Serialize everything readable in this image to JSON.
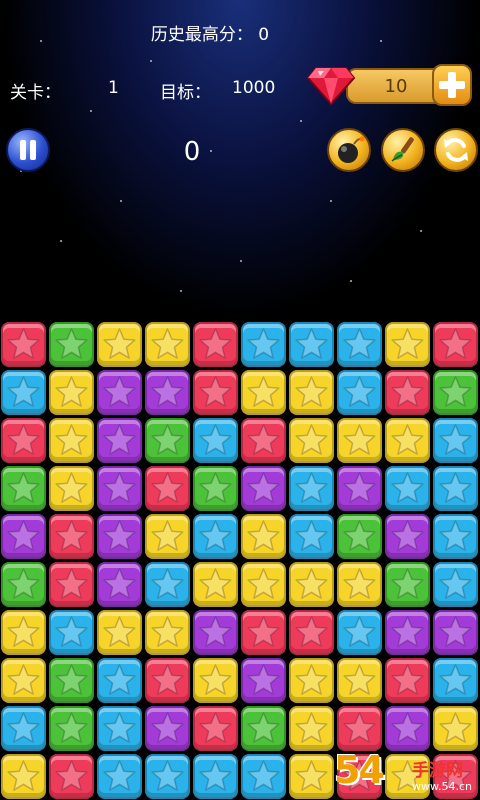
{
  "hud": {
    "best_score_label": "历史最高分：",
    "best_score_value": "0",
    "level_label": "关卡：",
    "level_value": "1",
    "target_label": "目标：",
    "target_value": "1000",
    "current_score": "0",
    "gem_count": "10"
  },
  "board": {
    "rows": 10,
    "cols": 10,
    "colors": {
      "R": "#ef3b5a",
      "G": "#4cc23a",
      "Y": "#f6d42a",
      "B": "#2bb2ea",
      "P": "#a23bd8"
    },
    "tiles": [
      "RGYYRBBBYR",
      "BYPPRYYBRG",
      "RYPGBRYYYB",
      "GYPRGPBPBB",
      "PRPYBYBGPB",
      "GRPBYYYYGB",
      "YBYYPRRBPP",
      "YGBRYPYYRB",
      "BGBPRGYRPY",
      "YRBBBBYRYR"
    ]
  },
  "watermark": {
    "number": "54",
    "brand": "手游网",
    "domain": "www.54.cn"
  }
}
